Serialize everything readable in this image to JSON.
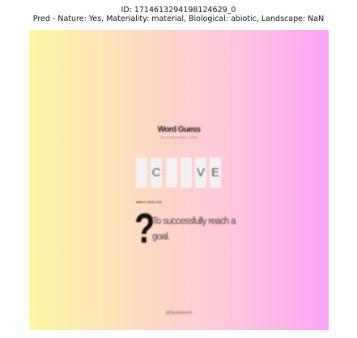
{
  "figure": {
    "title_line1": "ID: 1714613294198124629_0",
    "title_line2": "Pred - Nature: Yes, Materiality: material, Biological: abiotic, Landscape: NaN"
  },
  "puzzle": {
    "title": "Word Guess",
    "subtitle": "FILL IN THE MISSING LETTER",
    "letters": [
      "",
      "C",
      "",
      "",
      "V",
      "E"
    ],
    "clue_label": "HERE'S YOUR CLUE",
    "question_mark": "?",
    "clue": "To successfully reach a goal.",
    "footer": "@Quizexcom"
  }
}
